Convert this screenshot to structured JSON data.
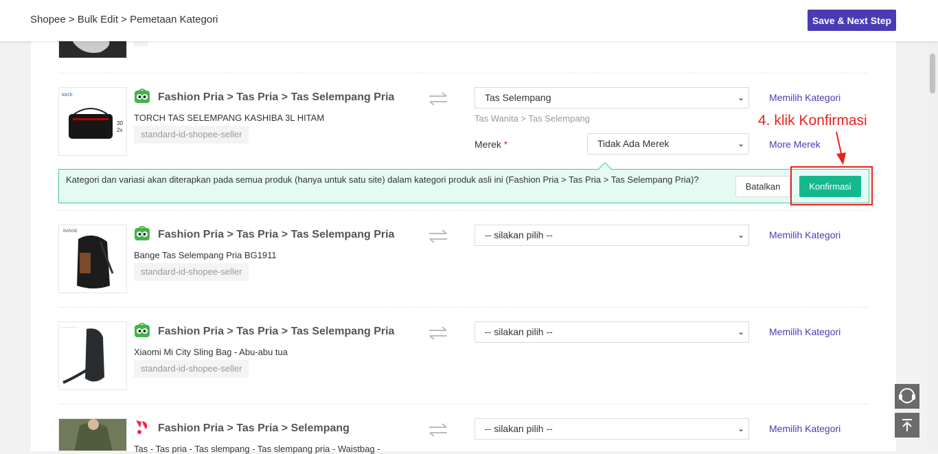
{
  "header": {
    "breadcrumb": "Shopee > Bulk Edit > Pemetaan Kategori",
    "save_label": "Save & Next Step"
  },
  "rows": [
    {
      "category": "Fashion Pria > Tas Pria > Tas Selempang Pria",
      "product": "TORCH TAS SELEMPANG KASHIBA 3L HITAM",
      "tag": "standard-id-shopee-seller",
      "select_value": "Tas Selempang",
      "select_path": "Tas Wanita > Tas Selempang",
      "link": "Memilih Kategori",
      "brand_label": "Merek",
      "brand_value": "Tidak Ada Merek",
      "brand_link": "More Merek"
    },
    {
      "category": "Fashion Pria > Tas Pria > Tas Selempang Pria",
      "product": "Bange Tas Selempang Pria BG1911",
      "tag": "standard-id-shopee-seller",
      "select_value": "-- silakan pilih --",
      "link": "Memilih Kategori"
    },
    {
      "category": "Fashion Pria > Tas Pria > Tas Selempang Pria",
      "product": "Xiaomi Mi City Sling Bag - Abu-abu tua",
      "tag": "standard-id-shopee-seller",
      "select_value": "-- silakan pilih --",
      "link": "Memilih Kategori"
    },
    {
      "category": "Fashion Pria > Tas Pria > Selempang",
      "product": "Tas - Tas pria - Tas slempang - Tas slempang pria - Waistbag -",
      "select_value": "-- silakan pilih --",
      "link": "Memilih Kategori"
    }
  ],
  "confirm_banner": {
    "text": "Kategori dan variasi akan diterapkan pada semua produk (hanya untuk satu site) dalam kategori produk asli ini (Fashion Pria > Tas Pria > Tas Selempang Pria)?",
    "cancel_label": "Batalkan",
    "confirm_label": "Konfirmasi"
  },
  "annotation": "4. klik Konfirmasi",
  "colors": {
    "brand": "#4a3bb5",
    "confirm": "#13b98c",
    "annotation": "#e8221c"
  }
}
